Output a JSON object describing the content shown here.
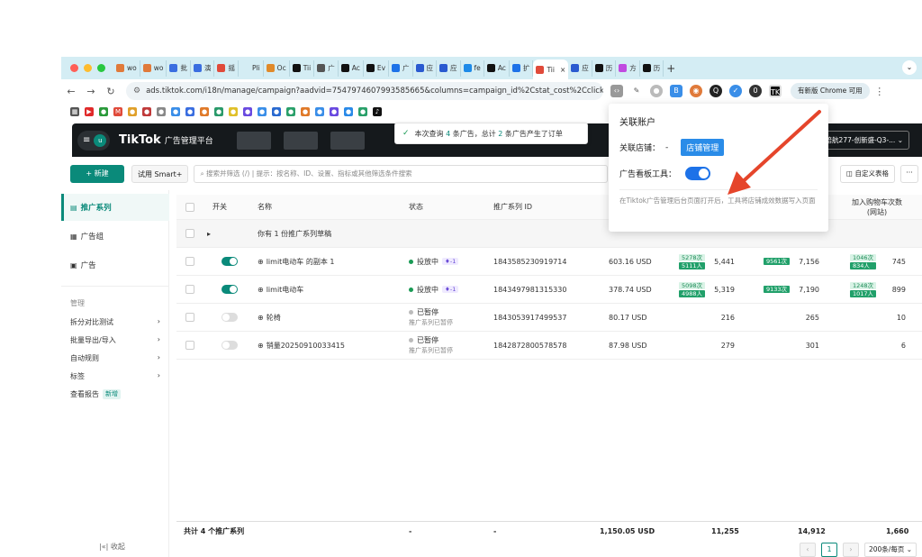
{
  "browser": {
    "tabs": [
      {
        "label": "wo",
        "color": "#e07a3a"
      },
      {
        "label": "wo",
        "color": "#e07a3a"
      },
      {
        "label": "批",
        "color": "#3a6ee0"
      },
      {
        "label": "演",
        "color": "#3a6ee0"
      },
      {
        "label": "摇",
        "color": "#e04a3a"
      },
      {
        "label": "Pli",
        "color": "#d4edf4"
      },
      {
        "label": "Oc",
        "color": "#e08a2a"
      },
      {
        "label": "Tii",
        "color": "#111111"
      },
      {
        "label": "广",
        "color": "#555555"
      },
      {
        "label": "Ac",
        "color": "#111111"
      },
      {
        "label": "Ev",
        "color": "#111111"
      },
      {
        "label": "广",
        "color": "#1d72e8"
      },
      {
        "label": "应",
        "color": "#2a5ad0"
      },
      {
        "label": "应",
        "color": "#2a5ad0"
      },
      {
        "label": "fe",
        "color": "#1d8ae8"
      },
      {
        "label": "Ac",
        "color": "#111111"
      },
      {
        "label": "扩",
        "color": "#1d72e8"
      },
      {
        "label": "Tii",
        "color": "#e04a3a"
      },
      {
        "label": "应",
        "color": "#2a5ad0"
      },
      {
        "label": "历",
        "color": "#111111"
      },
      {
        "label": "方",
        "color": "#c04ae0"
      },
      {
        "label": "历",
        "color": "#111111"
      }
    ],
    "active_tab_close": "×",
    "new_tab": "+",
    "url": "ads.tiktok.com/i18n/manage/campaign?aadvid=7547974607993585665&columns=campaign_id%2Cstat_cost%2Cclick_cnt%2Cti",
    "update_button": "有新版 Chrome 可用"
  },
  "tiktok": {
    "brand": "TikTok",
    "brand_sub": "广告管理平台",
    "avatar": "u",
    "account_selector": "陪航277-创新盛-Q3-..."
  },
  "toolbar": {
    "new_button": "+ 新建",
    "smart_button": "试用 Smart+",
    "search_placeholder": "搜索并筛选 (/) | 提示：按名称、ID、设置、指标或其他筛选条件搜索",
    "custom_table": "自定义表格",
    "more": "···"
  },
  "sidebar": {
    "items": [
      {
        "label": "推广系列",
        "icon": "folder-icon"
      },
      {
        "label": "广告组",
        "icon": "grid-icon"
      },
      {
        "label": "广告",
        "icon": "image-icon"
      }
    ],
    "section_label": "管理",
    "links": [
      {
        "label": "拆分对比测试"
      },
      {
        "label": "批量导出/导入"
      },
      {
        "label": "自动规则"
      },
      {
        "label": "标签"
      }
    ],
    "report_link": "查看报告",
    "new_badge": "新增",
    "collapse": "|«| 收起"
  },
  "table": {
    "headers": {
      "switch": "开关",
      "name": "名称",
      "status": "状态",
      "id": "推广系列 ID",
      "cart": "加入购物车次数",
      "cart_sub": "(网站)"
    },
    "draft_row": "你有 1 份推广系列草稿",
    "rows": [
      {
        "toggle": "on",
        "name": "limit电动车 的副本 1",
        "status": "投放中",
        "status_color": "#1a9a55",
        "status_sub": "",
        "pill": "1",
        "id": "1843585230919714",
        "cost": "603.16 USD",
        "tag1": "5278次",
        "tag2": "5111人",
        "v1": "5,441",
        "tag3": "9561次",
        "v2": "7,156",
        "tag4": "1046次",
        "tag5": "834人",
        "v3": "745"
      },
      {
        "toggle": "on",
        "name": "limit电动车",
        "status": "投放中",
        "status_color": "#1a9a55",
        "status_sub": "",
        "pill": "1",
        "id": "1843497981315330",
        "cost": "378.74 USD",
        "tag1": "5098次",
        "tag2": "4988人",
        "v1": "5,319",
        "tag3": "9133次",
        "v2": "7,190",
        "tag4": "1248次",
        "tag5": "1017人",
        "v3": "899"
      },
      {
        "toggle": "off",
        "name": "轮椅",
        "status": "已暂停",
        "status_color": "#bbbbbb",
        "status_sub": "推广系列已暂停",
        "pill": "",
        "id": "1843053917499537",
        "cost": "80.17 USD",
        "tag1": "",
        "tag2": "",
        "v1": "216",
        "tag3": "",
        "v2": "265",
        "tag4": "",
        "tag5": "",
        "v3": "10"
      },
      {
        "toggle": "off",
        "name": "销量20250910033415",
        "status": "已暂停",
        "status_color": "#bbbbbb",
        "status_sub": "推广系列已暂停",
        "pill": "",
        "id": "1842872800578578",
        "cost": "87.98 USD",
        "tag1": "",
        "tag2": "",
        "v1": "279",
        "tag3": "",
        "v2": "301",
        "tag4": "",
        "tag5": "",
        "v3": "6"
      }
    ],
    "footer": {
      "label": "共计 4 个推广系列",
      "status": "-",
      "id": "-",
      "cost": "1,150.05 USD",
      "v1": "11,255",
      "v2": "14,912",
      "v3": "1,660"
    },
    "pager": {
      "current": "1",
      "size": "200条/每页"
    }
  },
  "toast": {
    "pre": "本次查询",
    "n1": "4",
    "mid": "条广告，总计",
    "n2": "2",
    "post": "条广告产生了订单"
  },
  "popup": {
    "title": "关联账户",
    "shop_label": "关联店铺：",
    "shop_value": "-",
    "shop_button": "店铺管理",
    "tool_label": "广告看板工具：",
    "description": "在Tiktok广告管理后台页面打开后，工具将店铺成效数据写入页面"
  },
  "colors": {
    "accent": "#0a8a7a",
    "arrow": "#e5452b",
    "popup_blue": "#1d72e8"
  }
}
